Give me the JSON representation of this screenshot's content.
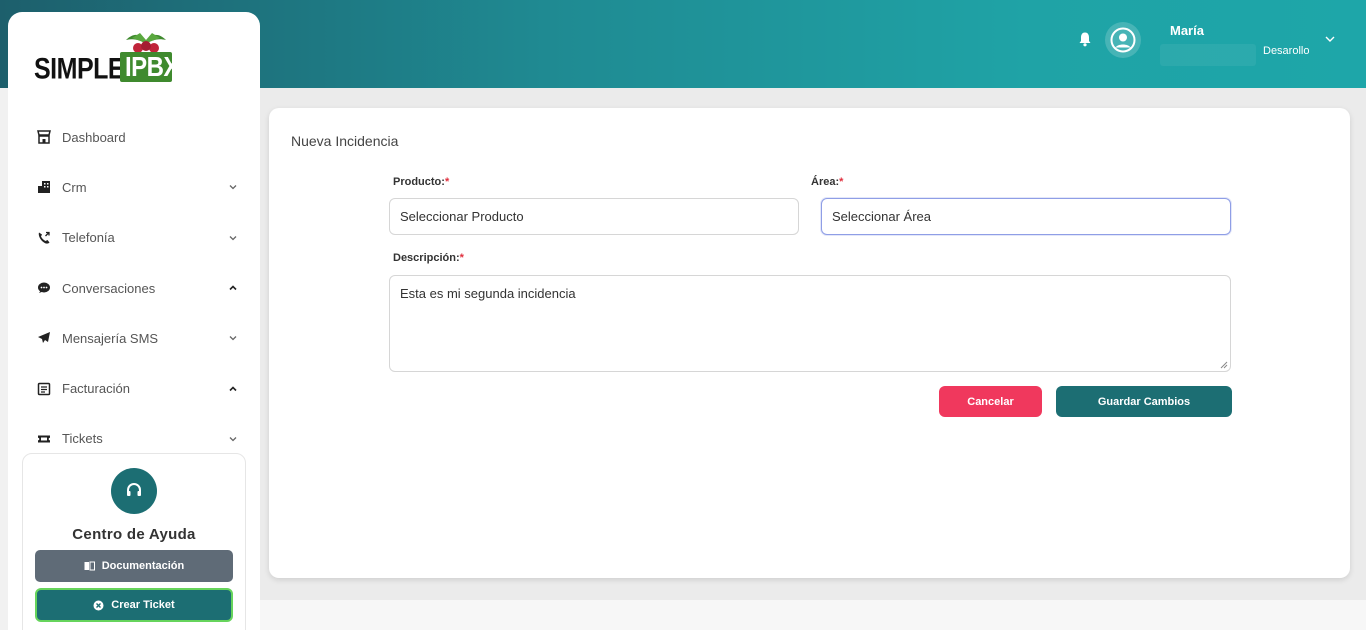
{
  "brand": {
    "simple": "SIMPLE",
    "ipbx": "IPBX"
  },
  "sidebar": {
    "items": [
      {
        "label": "Dashboard",
        "icon": "store-icon",
        "chevron": ""
      },
      {
        "label": "Crm",
        "icon": "building-icon",
        "chevron": "down"
      },
      {
        "label": "Telefonía",
        "icon": "phone-icon",
        "chevron": "down"
      },
      {
        "label": "Conversaciones",
        "icon": "chat-icon",
        "chevron": "up"
      },
      {
        "label": "Mensajería SMS",
        "icon": "send-icon",
        "chevron": "down"
      },
      {
        "label": "Facturación",
        "icon": "invoice-icon",
        "chevron": "up"
      },
      {
        "label": "Tickets",
        "icon": "ticket-icon",
        "chevron": "down"
      }
    ],
    "help": {
      "title": "Centro de Ayuda",
      "doc_label": "Documentación",
      "ticket_label": "Crear Ticket"
    }
  },
  "header": {
    "user_name": "María",
    "user_role": "Desarollo"
  },
  "form": {
    "title": "Nueva Incidencia",
    "producto_label": "Producto:",
    "producto_value": "Seleccionar Producto",
    "area_label": "Área:",
    "area_value": "Seleccionar Área",
    "descripcion_label": "Descripción:",
    "descripcion_value": "Esta es mi segunda incidencia",
    "required_mark": "*",
    "cancel_label": "Cancelar",
    "save_label": "Guardar Cambios"
  },
  "colors": {
    "primary": "#1c6e73",
    "danger": "#f0385d",
    "header_start": "#1d5f6c",
    "header_end": "#1ea6a9"
  }
}
